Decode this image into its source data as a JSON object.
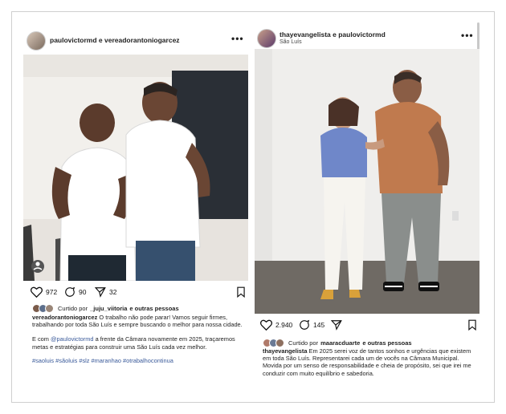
{
  "left_post": {
    "header": {
      "username": "paulovictormd e vereadorantoniogarcez",
      "more": "•••"
    },
    "actions": {
      "likes": "972",
      "comments": "90",
      "shares": "32"
    },
    "liked_by": {
      "prefix": "Curtido por",
      "user": "_juju_viitoria",
      "suffix": "e outras pessoas"
    },
    "caption": {
      "author": "vereadorantoniogarcez",
      "text1": "O trabalho não pode parar! Vamos seguir firmes, trabalhando por toda São Luís e sempre buscando o melhor para nossa cidade.",
      "text2_pre": "E com ",
      "text2_mention": "@paulovictormd",
      "text2_post": " a frente da Câmara novamente em 2025, traçaremos metas e estratégias para construir uma São Luís cada vez melhor.",
      "hashtags": "#saoluis #sãoluis #slz #maranhao #otrabalhocontinua"
    }
  },
  "right_post": {
    "header": {
      "username": "thayevangelista e paulovictormd",
      "location": "São Luís",
      "more": "•••"
    },
    "actions": {
      "likes": "2.940",
      "comments": "145"
    },
    "liked_by": {
      "prefix": "Curtido por",
      "user": "maaracduarte",
      "suffix": "e outras pessoas"
    },
    "caption": {
      "author": "thayevangelista",
      "text1": "Em 2025 serei voz de tantos sonhos e urgências que existem em toda São Luís. Representarei cada um de vocês na Câmara Municipal.",
      "text2": "Movida por um senso de responsabilidade e cheia de propósito, sei que irei me conduzir com muito equilíbrio e sabedoria."
    }
  },
  "icons": [
    "heart-icon",
    "comment-icon",
    "share-icon",
    "bookmark-icon",
    "user-tag-icon",
    "more-icon"
  ]
}
